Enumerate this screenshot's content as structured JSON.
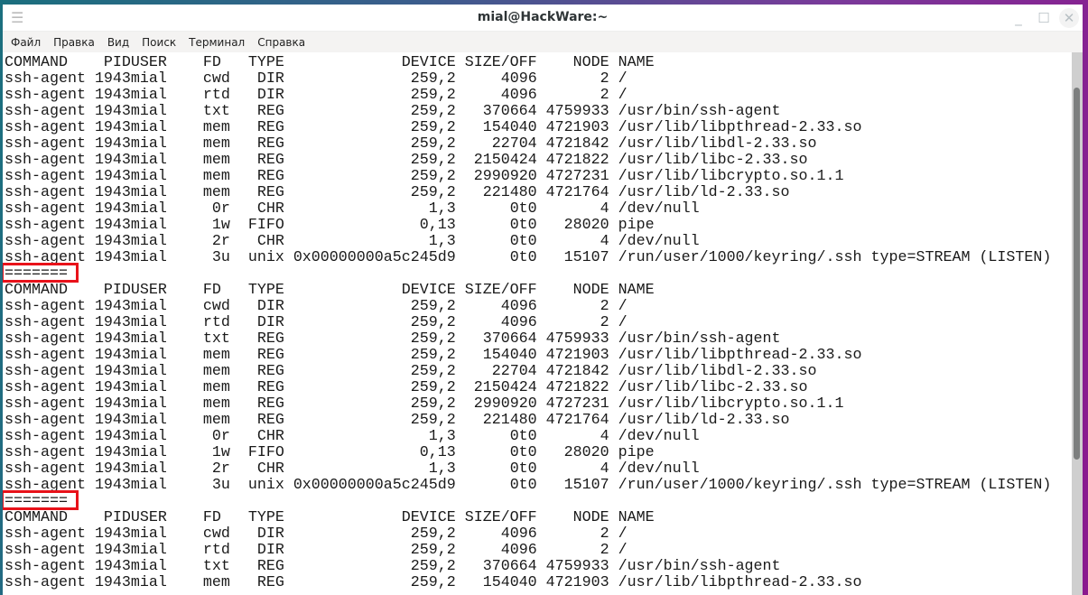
{
  "window": {
    "title": "mial@HackWare:~"
  },
  "menu": [
    "Файл",
    "Правка",
    "Вид",
    "Поиск",
    "Терминал",
    "Справка"
  ],
  "terminal": {
    "header": {
      "command": "COMMAND",
      "pid": "PID",
      "user": "USER",
      "fd": "FD",
      "type": "TYPE",
      "device": "DEVICE",
      "size": "SIZE/OFF",
      "node": "NODE",
      "name": "NAME"
    },
    "separator": "=======",
    "blocks": [
      {
        "rows": [
          [
            "ssh-agent",
            "1943",
            "mial",
            "cwd",
            "DIR",
            "259,2",
            "4096",
            "2",
            "/"
          ],
          [
            "ssh-agent",
            "1943",
            "mial",
            "rtd",
            "DIR",
            "259,2",
            "4096",
            "2",
            "/"
          ],
          [
            "ssh-agent",
            "1943",
            "mial",
            "txt",
            "REG",
            "259,2",
            "370664",
            "4759933",
            "/usr/bin/ssh-agent"
          ],
          [
            "ssh-agent",
            "1943",
            "mial",
            "mem",
            "REG",
            "259,2",
            "154040",
            "4721903",
            "/usr/lib/libpthread-2.33.so"
          ],
          [
            "ssh-agent",
            "1943",
            "mial",
            "mem",
            "REG",
            "259,2",
            "22704",
            "4721842",
            "/usr/lib/libdl-2.33.so"
          ],
          [
            "ssh-agent",
            "1943",
            "mial",
            "mem",
            "REG",
            "259,2",
            "2150424",
            "4721822",
            "/usr/lib/libc-2.33.so"
          ],
          [
            "ssh-agent",
            "1943",
            "mial",
            "mem",
            "REG",
            "259,2",
            "2990920",
            "4727231",
            "/usr/lib/libcrypto.so.1.1"
          ],
          [
            "ssh-agent",
            "1943",
            "mial",
            "mem",
            "REG",
            "259,2",
            "221480",
            "4721764",
            "/usr/lib/ld-2.33.so"
          ],
          [
            "ssh-agent",
            "1943",
            "mial",
            "0r",
            "CHR",
            "1,3",
            "0t0",
            "4",
            "/dev/null"
          ],
          [
            "ssh-agent",
            "1943",
            "mial",
            "1w",
            "FIFO",
            "0,13",
            "0t0",
            "28020",
            "pipe"
          ],
          [
            "ssh-agent",
            "1943",
            "mial",
            "2r",
            "CHR",
            "1,3",
            "0t0",
            "4",
            "/dev/null"
          ],
          [
            "ssh-agent",
            "1943",
            "mial",
            "3u",
            "unix",
            "0x00000000a5c245d9",
            "0t0",
            "15107",
            "/run/user/1000/keyring/.ssh type=STREAM (LISTEN)"
          ]
        ],
        "separator": true
      },
      {
        "rows": [
          [
            "ssh-agent",
            "1943",
            "mial",
            "cwd",
            "DIR",
            "259,2",
            "4096",
            "2",
            "/"
          ],
          [
            "ssh-agent",
            "1943",
            "mial",
            "rtd",
            "DIR",
            "259,2",
            "4096",
            "2",
            "/"
          ],
          [
            "ssh-agent",
            "1943",
            "mial",
            "txt",
            "REG",
            "259,2",
            "370664",
            "4759933",
            "/usr/bin/ssh-agent"
          ],
          [
            "ssh-agent",
            "1943",
            "mial",
            "mem",
            "REG",
            "259,2",
            "154040",
            "4721903",
            "/usr/lib/libpthread-2.33.so"
          ],
          [
            "ssh-agent",
            "1943",
            "mial",
            "mem",
            "REG",
            "259,2",
            "22704",
            "4721842",
            "/usr/lib/libdl-2.33.so"
          ],
          [
            "ssh-agent",
            "1943",
            "mial",
            "mem",
            "REG",
            "259,2",
            "2150424",
            "4721822",
            "/usr/lib/libc-2.33.so"
          ],
          [
            "ssh-agent",
            "1943",
            "mial",
            "mem",
            "REG",
            "259,2",
            "2990920",
            "4727231",
            "/usr/lib/libcrypto.so.1.1"
          ],
          [
            "ssh-agent",
            "1943",
            "mial",
            "mem",
            "REG",
            "259,2",
            "221480",
            "4721764",
            "/usr/lib/ld-2.33.so"
          ],
          [
            "ssh-agent",
            "1943",
            "mial",
            "0r",
            "CHR",
            "1,3",
            "0t0",
            "4",
            "/dev/null"
          ],
          [
            "ssh-agent",
            "1943",
            "mial",
            "1w",
            "FIFO",
            "0,13",
            "0t0",
            "28020",
            "pipe"
          ],
          [
            "ssh-agent",
            "1943",
            "mial",
            "2r",
            "CHR",
            "1,3",
            "0t0",
            "4",
            "/dev/null"
          ],
          [
            "ssh-agent",
            "1943",
            "mial",
            "3u",
            "unix",
            "0x00000000a5c245d9",
            "0t0",
            "15107",
            "/run/user/1000/keyring/.ssh type=STREAM (LISTEN)"
          ]
        ],
        "separator": true
      },
      {
        "rows": [
          [
            "ssh-agent",
            "1943",
            "mial",
            "cwd",
            "DIR",
            "259,2",
            "4096",
            "2",
            "/"
          ],
          [
            "ssh-agent",
            "1943",
            "mial",
            "rtd",
            "DIR",
            "259,2",
            "4096",
            "2",
            "/"
          ],
          [
            "ssh-agent",
            "1943",
            "mial",
            "txt",
            "REG",
            "259,2",
            "370664",
            "4759933",
            "/usr/bin/ssh-agent"
          ],
          [
            "ssh-agent",
            "1943",
            "mial",
            "mem",
            "REG",
            "259,2",
            "154040",
            "4721903",
            "/usr/lib/libpthread-2.33.so"
          ]
        ],
        "separator": false
      }
    ]
  },
  "colors": {
    "highlight": "#e8121a"
  }
}
